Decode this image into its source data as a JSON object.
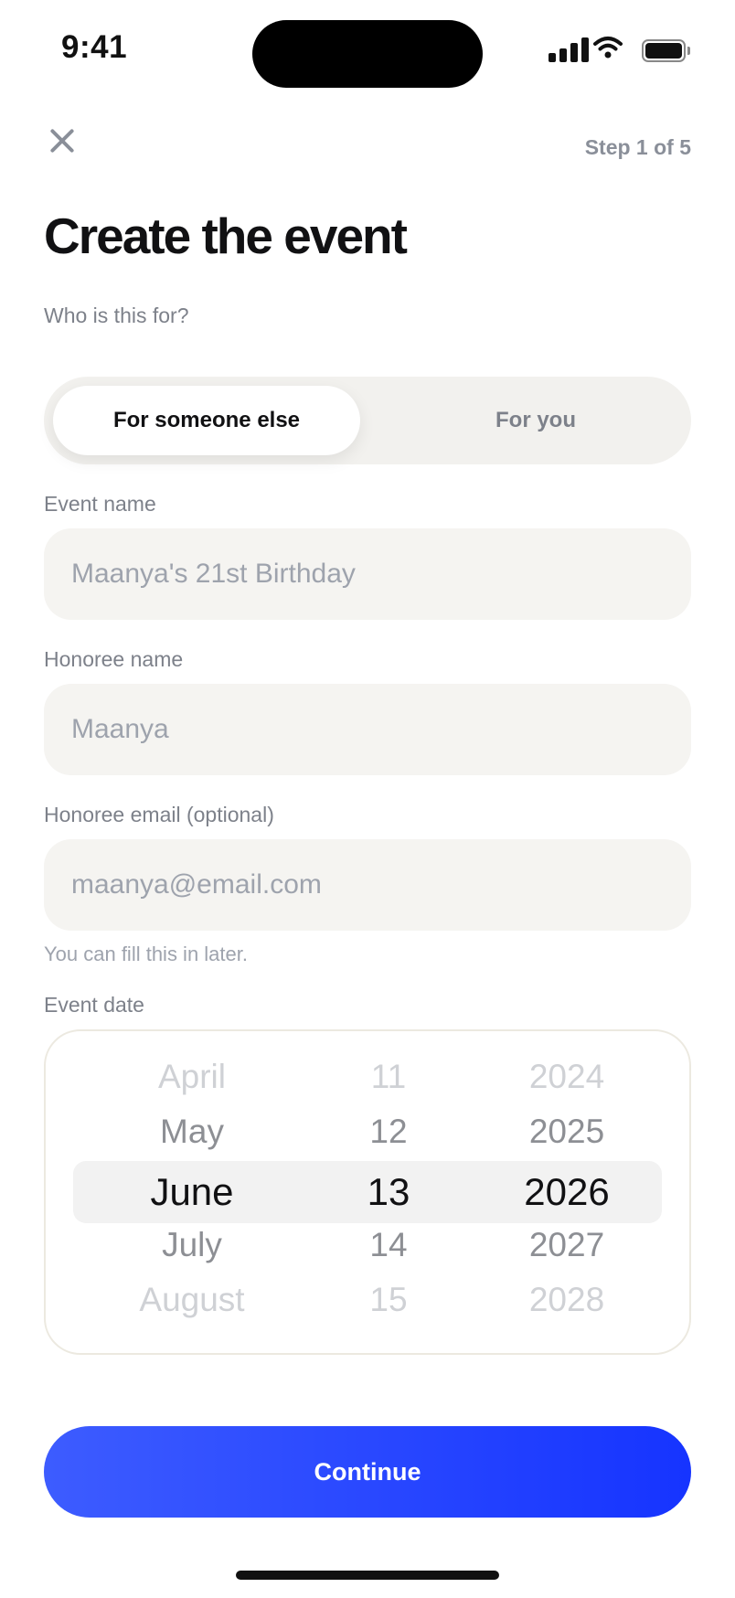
{
  "status_bar": {
    "time": "9:41",
    "icons": [
      "cellular-signal-icon",
      "wifi-icon",
      "battery-icon"
    ]
  },
  "header": {
    "close_icon": "close-icon",
    "step_label": "Step 1 of 5"
  },
  "title": "Create the event",
  "audience": {
    "label": "Who is this for?",
    "options": [
      "For someone else",
      "For you"
    ],
    "selected": "For someone else"
  },
  "event_name": {
    "label": "Event name",
    "placeholder": "Maanya's 21st Birthday",
    "value": ""
  },
  "honoree_name": {
    "label": "Honoree name",
    "placeholder": "Maanya",
    "value": ""
  },
  "honoree_email": {
    "label": "Honoree email (optional)",
    "placeholder": "maanya@email.com",
    "value": "",
    "helper": "You can fill this in later."
  },
  "event_date": {
    "label": "Event date",
    "months": [
      "April",
      "May",
      "June",
      "July",
      "August"
    ],
    "days": [
      "11",
      "12",
      "13",
      "14",
      "15"
    ],
    "years": [
      "2024",
      "2025",
      "2026",
      "2027",
      "2028"
    ],
    "selected": {
      "month": "June",
      "day": "13",
      "year": "2026"
    }
  },
  "continue_label": "Continue",
  "colors": {
    "accent_start": "#3d5cff",
    "accent_end": "#1634ff",
    "field_bg": "#f5f4f1",
    "muted_text": "#7d818a"
  }
}
